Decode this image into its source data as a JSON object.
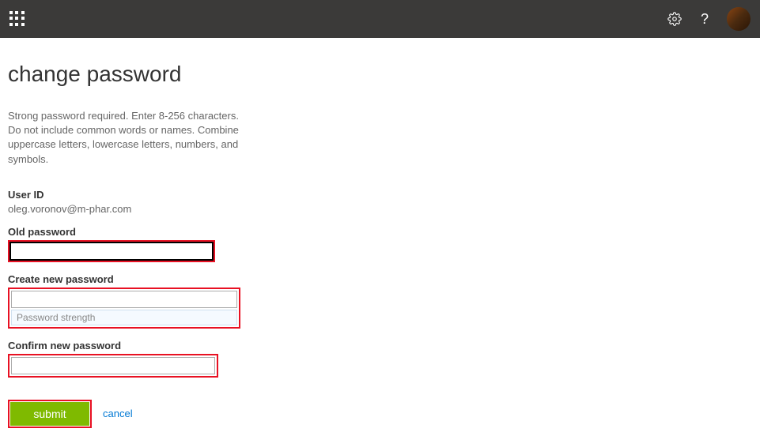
{
  "header": {
    "waffle_name": "app-launcher",
    "gear_name": "settings",
    "help_name": "help"
  },
  "page": {
    "title": "change password",
    "description": "Strong password required. Enter 8-256 characters. Do not include common words or names. Combine uppercase letters, lowercase letters, numbers, and symbols."
  },
  "form": {
    "user_id_label": "User ID",
    "user_id_value": "oleg.voronov@m-phar.com",
    "old_password_label": "Old password",
    "old_password_value": "",
    "new_password_label": "Create new password",
    "new_password_value": "",
    "strength_text": "Password strength",
    "confirm_password_label": "Confirm new password",
    "confirm_password_value": "",
    "submit_label": "submit",
    "cancel_label": "cancel"
  }
}
